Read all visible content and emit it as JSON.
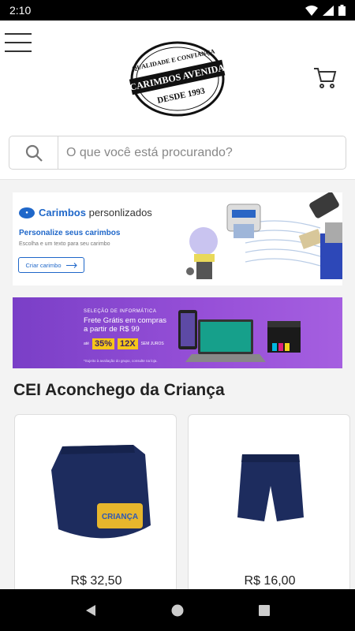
{
  "status_bar": {
    "time": "2:10"
  },
  "header": {
    "logo": {
      "top_text": "QUALIDADE E CONFIANÇA",
      "main_text": "CARIMBOS AVENIDA",
      "bottom_text": "DESDE 1993"
    }
  },
  "search": {
    "placeholder": "O que você está procurando?"
  },
  "banner_carimbos": {
    "brand_prefix": "Carimbos",
    "brand_suffix": "personlizados",
    "subtitle": "Personalize seus carimbos",
    "description": "Escolha e um texto para seu carimbo",
    "cta": "Criar carimbo"
  },
  "banner_informatica": {
    "kicker": "SELEÇÃO DE INFORMÁTICA",
    "headline_1": "Frete Grátis em compras",
    "headline_2": "a partir de R$ 99",
    "offer_pct": "35%",
    "offer_pct_note": "até",
    "offer_installments": "12X",
    "offer_installments_note": "SEM JUROS",
    "fine_print": "*Sujeito à avaliação do grupo, consulte na loja."
  },
  "section": {
    "title": "CEI Aconchego da Criança"
  },
  "products": [
    {
      "name": "Saia short azul marinho",
      "logo_text": "CRIANÇA",
      "price": "R$ 32,50"
    },
    {
      "name": "Short azul marinho",
      "price": "R$ 16,00"
    }
  ],
  "colors": {
    "brand_blue": "#1f67c9",
    "promo_purple": "#8a48d0",
    "promo_yellow": "#f6c619",
    "navy_uniform": "#1d2c5e"
  }
}
